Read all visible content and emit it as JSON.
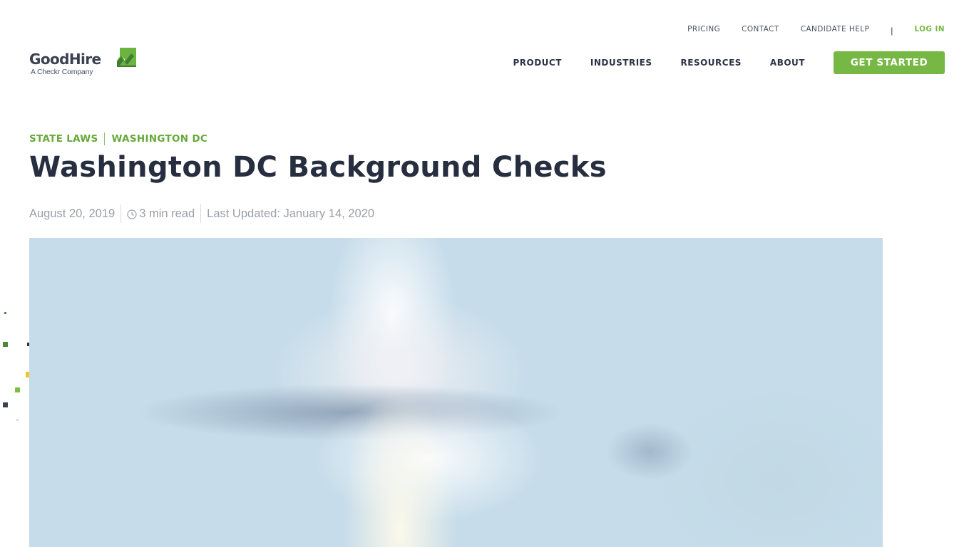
{
  "brand": {
    "name": "GoodHire",
    "tagline": "A Checkr Company",
    "accent_color": "#76b843",
    "text_color": "#262e3f"
  },
  "utility_nav": {
    "items": [
      {
        "label": "PRICING"
      },
      {
        "label": "CONTACT"
      },
      {
        "label": "CANDIDATE HELP"
      }
    ],
    "separator": "|",
    "login_label": "LOG IN"
  },
  "main_nav": {
    "items": [
      {
        "label": "PRODUCT"
      },
      {
        "label": "INDUSTRIES"
      },
      {
        "label": "RESOURCES"
      },
      {
        "label": "ABOUT"
      }
    ],
    "cta_label": "GET STARTED"
  },
  "article": {
    "breadcrumb": [
      {
        "label": "STATE LAWS"
      },
      {
        "label": "WASHINGTON DC"
      }
    ],
    "title": "Washington DC Background Checks",
    "meta": {
      "published": "August 20, 2019",
      "read_time_icon": "clock-icon",
      "read_time": "3 min read",
      "last_updated": "Last Updated: January 14, 2020"
    },
    "hero_image": {
      "description": "blurred image of a domed building against a light blue sky"
    }
  },
  "decorations": {
    "squares": [
      {
        "color": "#4c8a3a"
      },
      {
        "color": "#4c8a3a"
      },
      {
        "color": "#2c3344"
      },
      {
        "color": "#f2c431"
      },
      {
        "color": "#7bbf44"
      },
      {
        "color": "#3a4150"
      },
      {
        "color": "#cfe0ef"
      }
    ]
  }
}
